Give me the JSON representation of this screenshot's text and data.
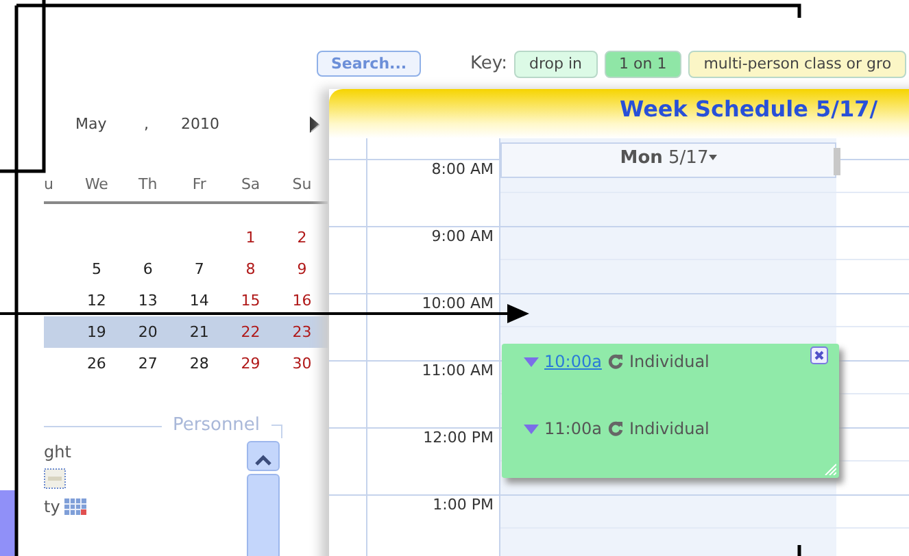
{
  "search_button": "Search...",
  "key": {
    "label": "Key:",
    "items": [
      {
        "label": "drop in",
        "color": "#dcfae6"
      },
      {
        "label": "1 on 1",
        "color": "#8fe6a6"
      },
      {
        "label": "multi-person class or gro",
        "color": "#fbf6c6"
      }
    ]
  },
  "calendar": {
    "month": "May",
    "separator": ",",
    "year": "2010",
    "weekdays": [
      "u",
      "We",
      "Th",
      "Fr",
      "Sa",
      "Su"
    ],
    "weeks": [
      {
        "selected": false,
        "days": [
          "1",
          "2"
        ]
      },
      {
        "selected": false,
        "days": [
          "5",
          "6",
          "7",
          "8",
          "9"
        ]
      },
      {
        "selected": false,
        "days": [
          "12",
          "13",
          "14",
          "15",
          "16"
        ]
      },
      {
        "selected": true,
        "days": [
          "19",
          "20",
          "21",
          "22",
          "23"
        ]
      },
      {
        "selected": false,
        "days": [
          "26",
          "27",
          "28",
          "29",
          "30"
        ]
      }
    ]
  },
  "personnel": {
    "legend": "Personnel",
    "lines": [
      "ght",
      "ty"
    ]
  },
  "schedule": {
    "title": "Week Schedule 5/17/",
    "day": {
      "name": "Mon",
      "date": "5/17"
    },
    "times": [
      "8:00 AM",
      "9:00 AM",
      "10:00 AM",
      "11:00 AM",
      "12:00 PM",
      "1:00 PM"
    ],
    "events": [
      {
        "time": "10:00a",
        "label": "Individual",
        "linked": true
      },
      {
        "time": "11:00a",
        "label": "Individual",
        "linked": false
      }
    ]
  }
}
